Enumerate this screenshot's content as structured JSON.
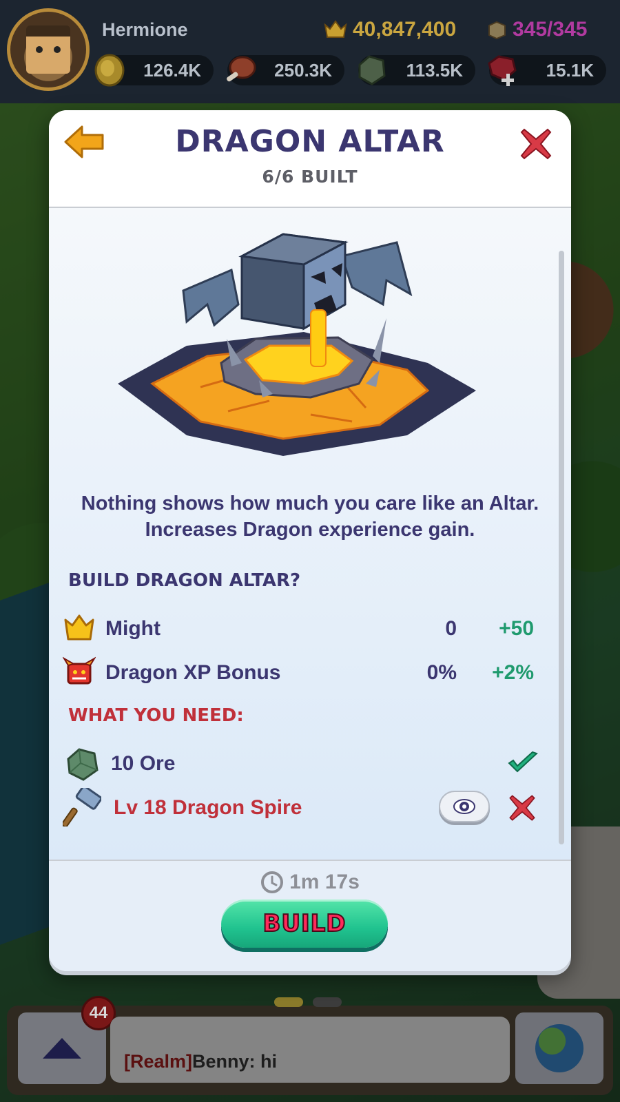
{
  "hud": {
    "player_name": "Hermione",
    "might_total": "40,847,400",
    "capacity": "345/345",
    "resources": [
      {
        "name": "gold",
        "icon": "gold-coin-icon",
        "value": "126.4K"
      },
      {
        "name": "food",
        "icon": "meat-icon",
        "value": "250.3K"
      },
      {
        "name": "ore",
        "icon": "ore-icon",
        "value": "113.5K"
      },
      {
        "name": "gems",
        "icon": "ruby-plus-icon",
        "value": "15.1K"
      }
    ]
  },
  "modal": {
    "title": "DRAGON ALTAR",
    "subtitle": "6/6 BUILT",
    "description": "Nothing shows how much you care like an Altar. Increases Dragon experience gain.",
    "build_section_title": "BUILD DRAGON ALTAR?",
    "stats": [
      {
        "icon": "crown-icon",
        "label": "Might",
        "current": "0",
        "increase": "+50"
      },
      {
        "icon": "dragon-head-icon",
        "label": "Dragon XP Bonus",
        "current": "0%",
        "increase": "+2%"
      }
    ],
    "need_section_title": "WHAT YOU NEED:",
    "requirements": [
      {
        "icon": "ore-icon",
        "label": "10 Ore",
        "met": true
      },
      {
        "icon": "hammer-icon",
        "label": "Lv 18 Dragon Spire",
        "met": false
      }
    ],
    "timer": "1m 17s",
    "build_label": "BUILD"
  },
  "bottom": {
    "badge_count": "44",
    "chat_realm": "[Realm]",
    "chat_message": "Benny: hi"
  },
  "colors": {
    "title": "#3b3670",
    "unmet": "#c0303a",
    "increase": "#1f9a6e",
    "build_button": "#20c38f"
  }
}
